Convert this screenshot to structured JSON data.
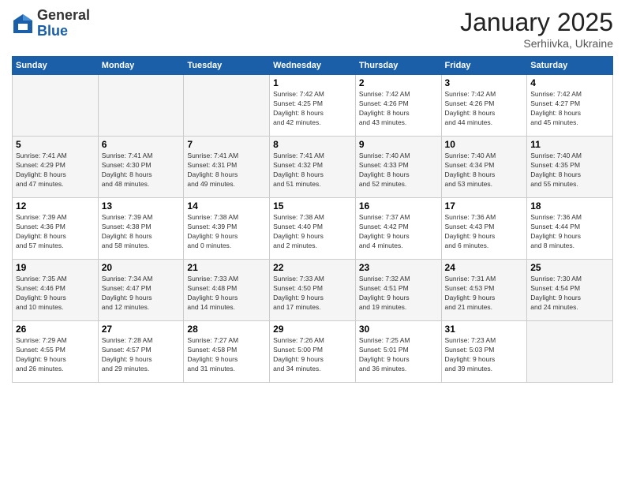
{
  "logo": {
    "general": "General",
    "blue": "Blue"
  },
  "header": {
    "month": "January 2025",
    "location": "Serhiivka, Ukraine"
  },
  "weekdays": [
    "Sunday",
    "Monday",
    "Tuesday",
    "Wednesday",
    "Thursday",
    "Friday",
    "Saturday"
  ],
  "weeks": [
    [
      {
        "day": "",
        "info": ""
      },
      {
        "day": "",
        "info": ""
      },
      {
        "day": "",
        "info": ""
      },
      {
        "day": "1",
        "info": "Sunrise: 7:42 AM\nSunset: 4:25 PM\nDaylight: 8 hours\nand 42 minutes."
      },
      {
        "day": "2",
        "info": "Sunrise: 7:42 AM\nSunset: 4:26 PM\nDaylight: 8 hours\nand 43 minutes."
      },
      {
        "day": "3",
        "info": "Sunrise: 7:42 AM\nSunset: 4:26 PM\nDaylight: 8 hours\nand 44 minutes."
      },
      {
        "day": "4",
        "info": "Sunrise: 7:42 AM\nSunset: 4:27 PM\nDaylight: 8 hours\nand 45 minutes."
      }
    ],
    [
      {
        "day": "5",
        "info": "Sunrise: 7:41 AM\nSunset: 4:29 PM\nDaylight: 8 hours\nand 47 minutes."
      },
      {
        "day": "6",
        "info": "Sunrise: 7:41 AM\nSunset: 4:30 PM\nDaylight: 8 hours\nand 48 minutes."
      },
      {
        "day": "7",
        "info": "Sunrise: 7:41 AM\nSunset: 4:31 PM\nDaylight: 8 hours\nand 49 minutes."
      },
      {
        "day": "8",
        "info": "Sunrise: 7:41 AM\nSunset: 4:32 PM\nDaylight: 8 hours\nand 51 minutes."
      },
      {
        "day": "9",
        "info": "Sunrise: 7:40 AM\nSunset: 4:33 PM\nDaylight: 8 hours\nand 52 minutes."
      },
      {
        "day": "10",
        "info": "Sunrise: 7:40 AM\nSunset: 4:34 PM\nDaylight: 8 hours\nand 53 minutes."
      },
      {
        "day": "11",
        "info": "Sunrise: 7:40 AM\nSunset: 4:35 PM\nDaylight: 8 hours\nand 55 minutes."
      }
    ],
    [
      {
        "day": "12",
        "info": "Sunrise: 7:39 AM\nSunset: 4:36 PM\nDaylight: 8 hours\nand 57 minutes."
      },
      {
        "day": "13",
        "info": "Sunrise: 7:39 AM\nSunset: 4:38 PM\nDaylight: 8 hours\nand 58 minutes."
      },
      {
        "day": "14",
        "info": "Sunrise: 7:38 AM\nSunset: 4:39 PM\nDaylight: 9 hours\nand 0 minutes."
      },
      {
        "day": "15",
        "info": "Sunrise: 7:38 AM\nSunset: 4:40 PM\nDaylight: 9 hours\nand 2 minutes."
      },
      {
        "day": "16",
        "info": "Sunrise: 7:37 AM\nSunset: 4:42 PM\nDaylight: 9 hours\nand 4 minutes."
      },
      {
        "day": "17",
        "info": "Sunrise: 7:36 AM\nSunset: 4:43 PM\nDaylight: 9 hours\nand 6 minutes."
      },
      {
        "day": "18",
        "info": "Sunrise: 7:36 AM\nSunset: 4:44 PM\nDaylight: 9 hours\nand 8 minutes."
      }
    ],
    [
      {
        "day": "19",
        "info": "Sunrise: 7:35 AM\nSunset: 4:46 PM\nDaylight: 9 hours\nand 10 minutes."
      },
      {
        "day": "20",
        "info": "Sunrise: 7:34 AM\nSunset: 4:47 PM\nDaylight: 9 hours\nand 12 minutes."
      },
      {
        "day": "21",
        "info": "Sunrise: 7:33 AM\nSunset: 4:48 PM\nDaylight: 9 hours\nand 14 minutes."
      },
      {
        "day": "22",
        "info": "Sunrise: 7:33 AM\nSunset: 4:50 PM\nDaylight: 9 hours\nand 17 minutes."
      },
      {
        "day": "23",
        "info": "Sunrise: 7:32 AM\nSunset: 4:51 PM\nDaylight: 9 hours\nand 19 minutes."
      },
      {
        "day": "24",
        "info": "Sunrise: 7:31 AM\nSunset: 4:53 PM\nDaylight: 9 hours\nand 21 minutes."
      },
      {
        "day": "25",
        "info": "Sunrise: 7:30 AM\nSunset: 4:54 PM\nDaylight: 9 hours\nand 24 minutes."
      }
    ],
    [
      {
        "day": "26",
        "info": "Sunrise: 7:29 AM\nSunset: 4:55 PM\nDaylight: 9 hours\nand 26 minutes."
      },
      {
        "day": "27",
        "info": "Sunrise: 7:28 AM\nSunset: 4:57 PM\nDaylight: 9 hours\nand 29 minutes."
      },
      {
        "day": "28",
        "info": "Sunrise: 7:27 AM\nSunset: 4:58 PM\nDaylight: 9 hours\nand 31 minutes."
      },
      {
        "day": "29",
        "info": "Sunrise: 7:26 AM\nSunset: 5:00 PM\nDaylight: 9 hours\nand 34 minutes."
      },
      {
        "day": "30",
        "info": "Sunrise: 7:25 AM\nSunset: 5:01 PM\nDaylight: 9 hours\nand 36 minutes."
      },
      {
        "day": "31",
        "info": "Sunrise: 7:23 AM\nSunset: 5:03 PM\nDaylight: 9 hours\nand 39 minutes."
      },
      {
        "day": "",
        "info": ""
      }
    ]
  ]
}
